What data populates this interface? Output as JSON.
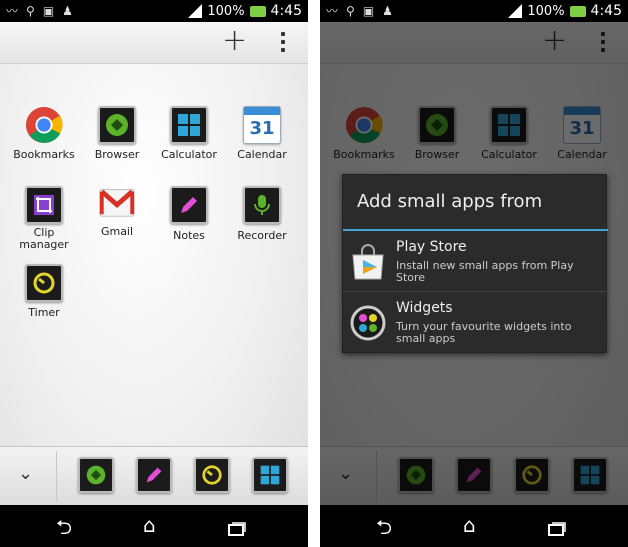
{
  "status": {
    "battery": "100%",
    "time": "4:45"
  },
  "toolbar": {
    "add": "+"
  },
  "apps": [
    {
      "label": "Bookmarks"
    },
    {
      "label": "Browser"
    },
    {
      "label": "Calculator"
    },
    {
      "label": "Calendar",
      "badge": "31"
    },
    {
      "label": "Clip\nmanager"
    },
    {
      "label": "Gmail"
    },
    {
      "label": "Notes"
    },
    {
      "label": "Recorder"
    },
    {
      "label": "Timer"
    }
  ],
  "dialog": {
    "title": "Add small apps from",
    "options": [
      {
        "title": "Play Store",
        "subtitle": "Install new small apps from Play Store"
      },
      {
        "title": "Widgets",
        "subtitle": "Turn your favourite widgets into small apps"
      }
    ]
  },
  "colors": {
    "accent": "#3fa6d6",
    "battery": "#7fd048"
  }
}
